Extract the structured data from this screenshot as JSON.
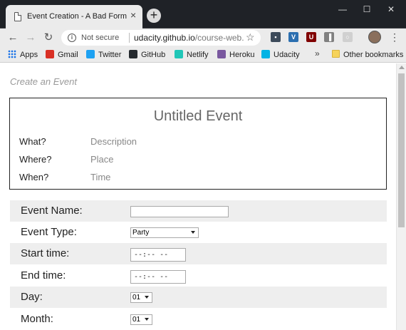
{
  "browser": {
    "tab_title": "Event Creation - A Bad Form",
    "tab_close": "×",
    "new_tab": "+",
    "window_controls": {
      "minimize": "—",
      "maximize": "☐",
      "close": "✕"
    },
    "nav": {
      "back": "←",
      "forward": "→",
      "reload": "↻"
    },
    "security_label": "Not secure",
    "url_host": "udacity.github.io",
    "url_path": "/course-web...",
    "star": "☆",
    "menu": "⋮",
    "extensions": [
      {
        "name": "ext-dark-icon",
        "letter": "▪",
        "color": "#3c4a5a"
      },
      {
        "name": "ext-v-icon",
        "letter": "V",
        "color": "#2c6fb0"
      },
      {
        "name": "ublock-icon",
        "letter": "U",
        "color": "#800000"
      },
      {
        "name": "ext-columns-icon",
        "letter": "▐",
        "color": "#808080"
      },
      {
        "name": "ext-circle-icon",
        "letter": "○",
        "color": "#d0d0d0"
      }
    ],
    "bookmarks": [
      {
        "label": "Apps",
        "icon": "apps-grid-icon",
        "color": "#1a73e8"
      },
      {
        "label": "Gmail",
        "icon": "gmail-icon",
        "color": "#d93025"
      },
      {
        "label": "Twitter",
        "icon": "twitter-icon",
        "color": "#1da1f2"
      },
      {
        "label": "GitHub",
        "icon": "github-icon",
        "color": "#24292e"
      },
      {
        "label": "Netlify",
        "icon": "netlify-icon",
        "color": "#20c6b7"
      },
      {
        "label": "Heroku",
        "icon": "heroku-icon",
        "color": "#79589f"
      },
      {
        "label": "Udacity",
        "icon": "udacity-icon",
        "color": "#02b3e4"
      }
    ],
    "overflow": "»",
    "other_bookmarks": "Other bookmarks"
  },
  "page": {
    "heading": "Create an Event",
    "preview": {
      "title": "Untitled Event",
      "rows": [
        {
          "label": "What?",
          "value": "Description"
        },
        {
          "label": "Where?",
          "value": "Place"
        },
        {
          "label": "When?",
          "value": "Time"
        }
      ]
    },
    "form": {
      "event_name": {
        "label": "Event Name:",
        "value": ""
      },
      "event_type": {
        "label": "Event Type:",
        "value": "Party"
      },
      "start_time": {
        "label": "Start time:",
        "value": "--:-- --"
      },
      "end_time": {
        "label": "End time:",
        "value": "--:-- --"
      },
      "day": {
        "label": "Day:",
        "value": "01"
      },
      "month": {
        "label": "Month:",
        "value": "01"
      }
    }
  }
}
